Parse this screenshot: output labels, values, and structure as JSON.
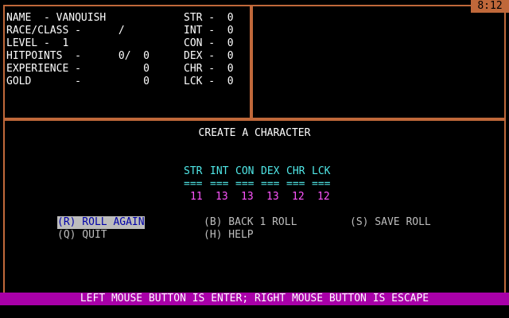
{
  "clock": "8:12",
  "character": [
    {
      "label": "NAME  - VANQUISH",
      "stat": "STR -  0"
    },
    {
      "label": "RACE/CLASS -      /",
      "stat": "INT -  0"
    },
    {
      "label": "LEVEL -  1",
      "stat": "CON -  0"
    },
    {
      "label": "HITPOINTS  -      0/  0",
      "stat": "DEX -  0"
    },
    {
      "label": "EXPERIENCE -          0",
      "stat": "CHR -  0"
    },
    {
      "label": "GOLD       -          0",
      "stat": "LCK -  0"
    }
  ],
  "create": {
    "title": "CREATE A CHARACTER",
    "stats": [
      {
        "name": "STR",
        "sep": "===",
        "value": "11"
      },
      {
        "name": "INT",
        "sep": "===",
        "value": "13"
      },
      {
        "name": "CON",
        "sep": "===",
        "value": "13"
      },
      {
        "name": "DEX",
        "sep": "===",
        "value": "13"
      },
      {
        "name": "CHR",
        "sep": "===",
        "value": "12"
      },
      {
        "name": "LCK",
        "sep": "===",
        "value": "12"
      }
    ]
  },
  "menu": {
    "roll_again": "(R) ROLL AGAIN",
    "back_roll": "(B) BACK 1 ROLL",
    "save_roll": "(S) SAVE ROLL",
    "quit": "(Q) QUIT",
    "help": "(H) HELP"
  },
  "footer": "LEFT MOUSE BUTTON IS ENTER; RIGHT MOUSE BUTTON IS ESCAPE"
}
